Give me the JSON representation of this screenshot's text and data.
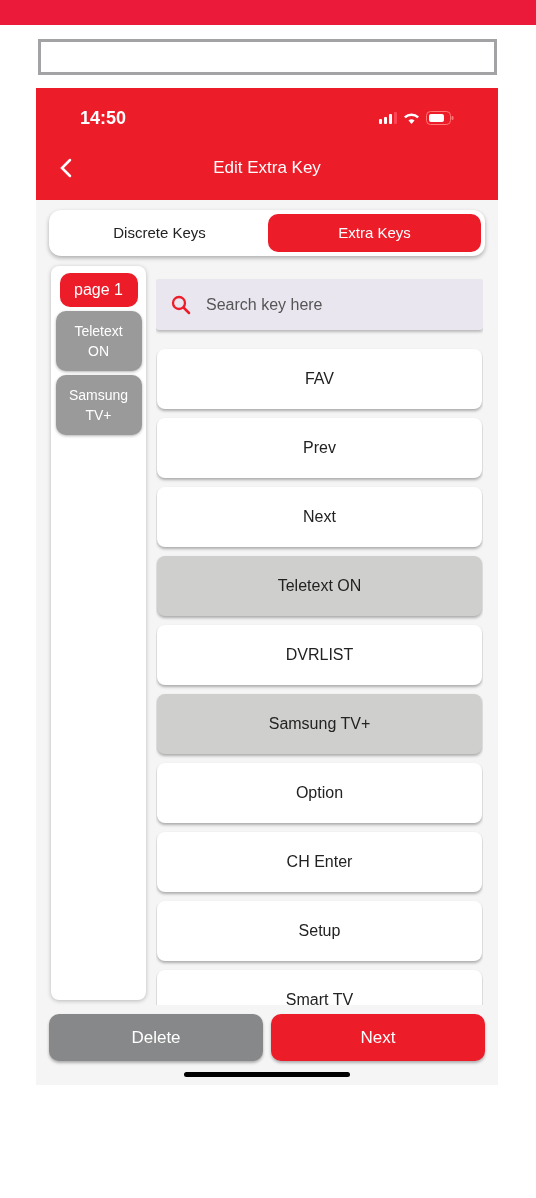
{
  "status_bar": {
    "time": "14:50"
  },
  "header": {
    "title": "Edit Extra Key"
  },
  "tabs": [
    {
      "label": "Discrete Keys",
      "selected": false
    },
    {
      "label": "Extra Keys",
      "selected": true
    }
  ],
  "sidebar": {
    "items": [
      {
        "label": "page 1",
        "kind": "page"
      },
      {
        "label": "Teletext ON",
        "kind": "key"
      },
      {
        "label": "Samsung TV+",
        "kind": "key"
      }
    ]
  },
  "search": {
    "placeholder": "Search key here"
  },
  "keys": [
    {
      "label": "FAV",
      "added": false
    },
    {
      "label": "Prev",
      "added": false
    },
    {
      "label": "Next",
      "added": false
    },
    {
      "label": "Teletext ON",
      "added": true
    },
    {
      "label": "DVRLIST",
      "added": false
    },
    {
      "label": "Samsung TV+",
      "added": true
    },
    {
      "label": "Option",
      "added": false
    },
    {
      "label": "CH Enter",
      "added": false
    },
    {
      "label": "Setup",
      "added": false
    },
    {
      "label": "Smart TV",
      "added": false
    }
  ],
  "buttons": [
    {
      "label": "Delete",
      "kind": "secondary"
    },
    {
      "label": "Next",
      "kind": "primary"
    }
  ]
}
